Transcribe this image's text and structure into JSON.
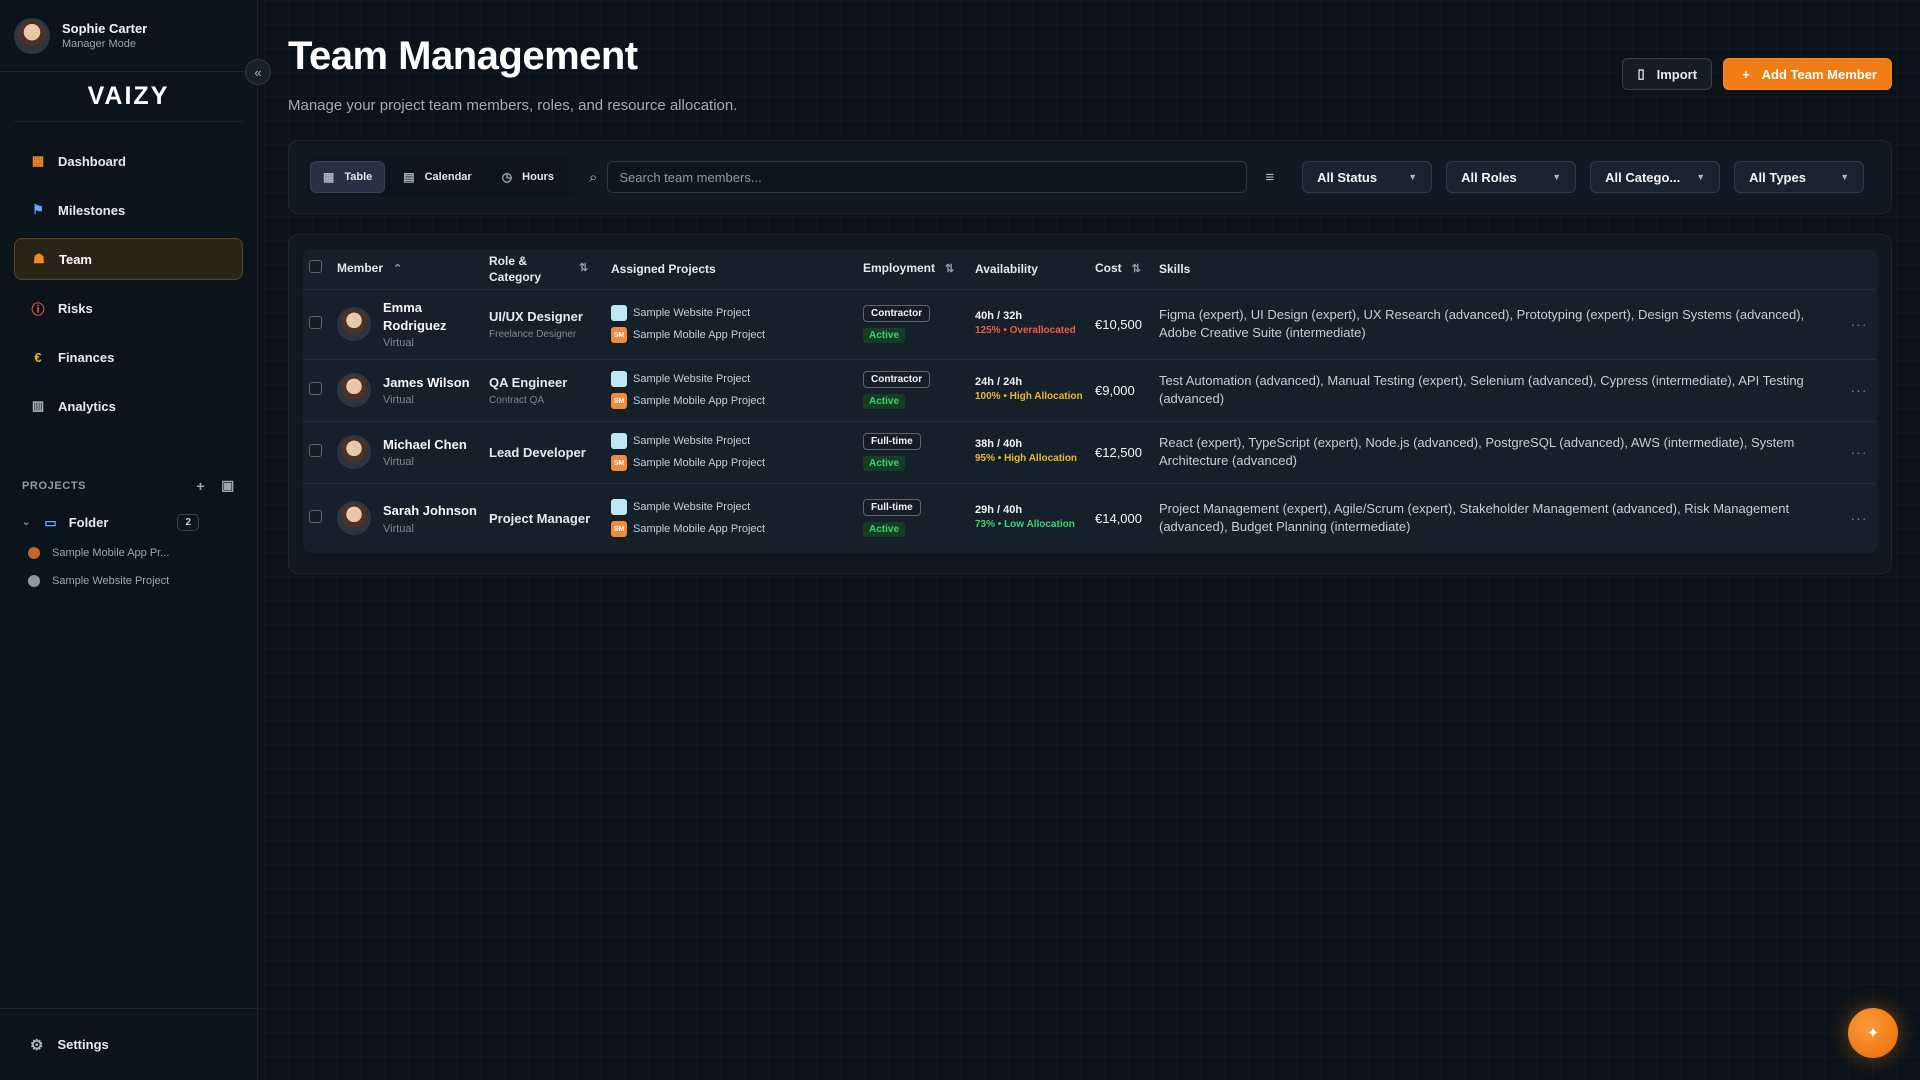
{
  "user": {
    "name": "Sophie Carter",
    "mode": "Manager Mode"
  },
  "app": {
    "logo": "VAIZY"
  },
  "nav": [
    {
      "label": "Dashboard",
      "icon": "dashboard-icon"
    },
    {
      "label": "Milestones",
      "icon": "flag-icon"
    },
    {
      "label": "Team",
      "icon": "team-icon",
      "active": true
    },
    {
      "label": "Risks",
      "icon": "alert-icon"
    },
    {
      "label": "Finances",
      "icon": "euro-icon"
    },
    {
      "label": "Analytics",
      "icon": "chart-icon"
    }
  ],
  "projects": {
    "heading": "PROJECTS",
    "folder": {
      "label": "Folder",
      "count": "2"
    },
    "items": [
      {
        "label": "Sample Mobile App Pr...",
        "color": "#c0652e"
      },
      {
        "label": "Sample Website Project",
        "color": "#8d9aa6"
      }
    ]
  },
  "settings": {
    "label": "Settings"
  },
  "page": {
    "title": "Team Management",
    "subtitle": "Manage your project team members, roles, and resource allocation."
  },
  "actions": {
    "import_label": "Import",
    "add_label": "Add Team Member"
  },
  "views": [
    {
      "label": "Table",
      "active": true
    },
    {
      "label": "Calendar"
    },
    {
      "label": "Hours"
    }
  ],
  "search": {
    "placeholder": "Search team members..."
  },
  "filters": {
    "status": "All Status",
    "roles": "All Roles",
    "category": "All Catego...",
    "types": "All Types"
  },
  "table": {
    "headers": {
      "member": "Member",
      "role": "Role & Category",
      "projects": "Assigned Projects",
      "employment": "Employment",
      "availability": "Availability",
      "cost": "Cost",
      "skills": "Skills"
    },
    "project_badges": {
      "website": "",
      "mobile": "SM"
    },
    "rows": [
      {
        "name": "Emma Rodriguez",
        "type": "Virtual",
        "role": "UI/UX Designer",
        "category": "Freelance Designer",
        "projects": [
          "Sample Website Project",
          "Sample Mobile App Project"
        ],
        "employment": "Contractor",
        "status": "Active",
        "hours": "40h / 32h",
        "allocation": "125% • Overallocated",
        "allocation_level": "over",
        "cost": "€10,500",
        "skills": "Figma (expert), UI Design (expert), UX Research (advanced), Prototyping (expert), Design Systems (advanced), Adobe Creative Suite (intermediate)"
      },
      {
        "name": "James Wilson",
        "type": "Virtual",
        "role": "QA Engineer",
        "category": "Contract QA",
        "projects": [
          "Sample Website Project",
          "Sample Mobile App Project"
        ],
        "employment": "Contractor",
        "status": "Active",
        "hours": "24h / 24h",
        "allocation": "100% • High Allocation",
        "allocation_level": "high",
        "cost": "€9,000",
        "skills": "Test Automation (advanced), Manual Testing (expert), Selenium (advanced), Cypress (intermediate), API Testing (advanced)"
      },
      {
        "name": "Michael Chen",
        "type": "Virtual",
        "role": "Lead Developer",
        "category": "",
        "projects": [
          "Sample Website Project",
          "Sample Mobile App Project"
        ],
        "employment": "Full-time",
        "status": "Active",
        "hours": "38h / 40h",
        "allocation": "95% • High Allocation",
        "allocation_level": "high",
        "cost": "€12,500",
        "skills": "React (expert), TypeScript (expert), Node.js (advanced), PostgreSQL (advanced), AWS (intermediate), System Architecture (advanced)"
      },
      {
        "name": "Sarah Johnson",
        "type": "Virtual",
        "role": "Project Manager",
        "category": "",
        "projects": [
          "Sample Website Project",
          "Sample Mobile App Project"
        ],
        "employment": "Full-time",
        "status": "Active",
        "hours": "29h / 40h",
        "allocation": "73% • Low Allocation",
        "allocation_level": "low",
        "cost": "€14,000",
        "skills": "Project Management (expert), Agile/Scrum (expert), Stakeholder Management (advanced), Risk Management (advanced), Budget Planning (intermediate)"
      }
    ]
  },
  "colors": {
    "accent": "#f07d14",
    "background": "#0b1219",
    "active_green": "#3ed46f",
    "overallocated_red": "#ef5b4d",
    "high_yellow": "#e5b935"
  }
}
